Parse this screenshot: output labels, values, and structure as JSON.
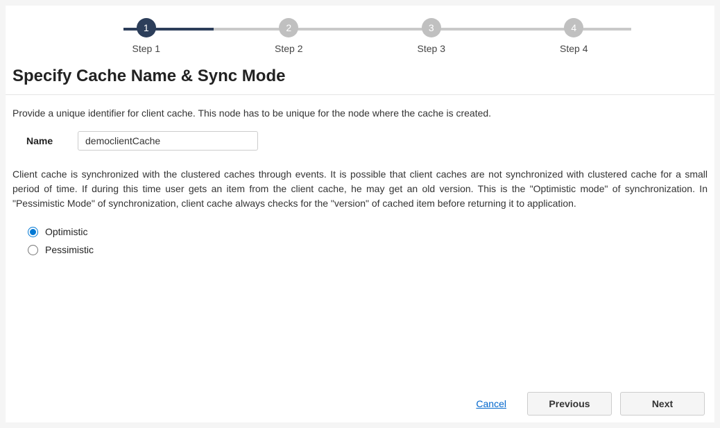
{
  "stepper": {
    "steps": [
      {
        "num": "1",
        "label": "Step 1",
        "active": true
      },
      {
        "num": "2",
        "label": "Step 2",
        "active": false
      },
      {
        "num": "3",
        "label": "Step 3",
        "active": false
      },
      {
        "num": "4",
        "label": "Step 4",
        "active": false
      }
    ]
  },
  "page": {
    "title": "Specify Cache Name & Sync Mode",
    "intro": "Provide a unique identifier for client cache. This node has to be unique for the node where the cache is created.",
    "name_label": "Name",
    "name_value": "democlientCache",
    "description": "Client cache is synchronized with the clustered caches through events. It is possible that client caches are not synchronized with clustered cache for a small period of time. If during this time user gets an item from the client cache, he may get an old version. This is the \"Optimistic mode\" of synchronization. In \"Pessimistic Mode\" of synchronization, client cache always checks for the \"version\" of cached item before returning it to application."
  },
  "sync_mode": {
    "options": [
      {
        "label": "Optimistic",
        "selected": true
      },
      {
        "label": "Pessimistic",
        "selected": false
      }
    ]
  },
  "footer": {
    "cancel": "Cancel",
    "previous": "Previous",
    "next": "Next"
  }
}
